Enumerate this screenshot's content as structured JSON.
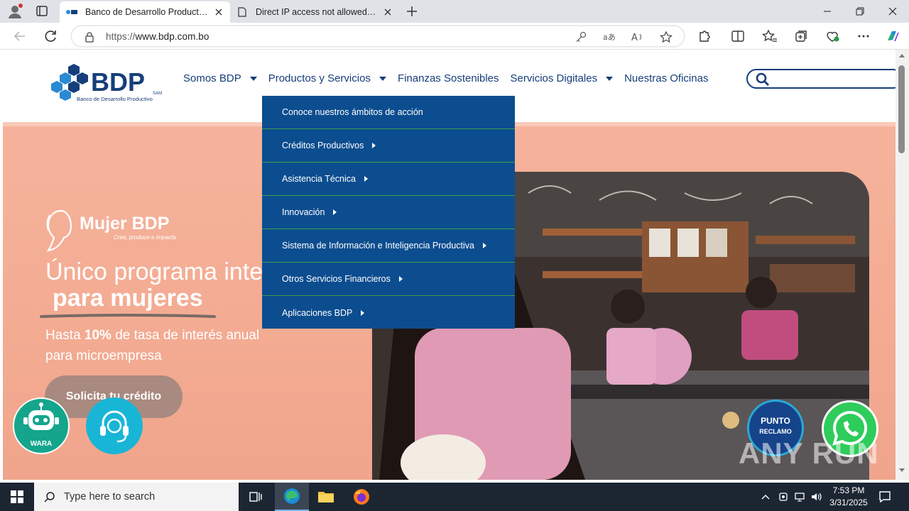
{
  "browser": {
    "tabs": [
      {
        "title": "Banco de Desarrollo Productivo -",
        "active": true
      },
      {
        "title": "Direct IP access not allowed | Clo",
        "active": false
      }
    ],
    "url_host": "https://www.bdp.com.bo",
    "url_scheme": "https://",
    "url_domain": "www.bdp.com.bo"
  },
  "site": {
    "logo_text": "BDP",
    "logo_sam": "SAM",
    "logo_subtitle": "Banco de Desarrollo Productivo",
    "menu": [
      {
        "label": "Somos BDP",
        "has_caret": true
      },
      {
        "label": "Productos y Servicios",
        "has_caret": true
      },
      {
        "label": "Finanzas Sostenibles",
        "has_caret": false
      },
      {
        "label": "Servicios Digitales",
        "has_caret": true
      },
      {
        "label": "Nuestras Oficinas",
        "has_caret": false
      }
    ],
    "dropdown": [
      {
        "label": "Conoce nuestros ámbitos de acción",
        "sub": false
      },
      {
        "label": "Créditos Productivos",
        "sub": true
      },
      {
        "label": "Asistencia Técnica",
        "sub": true
      },
      {
        "label": "Innovación",
        "sub": true
      },
      {
        "label": "Sistema de Información e Inteligencia Productiva",
        "sub": true
      },
      {
        "label": "Otros Servicios Financieros",
        "sub": true
      },
      {
        "label": "Aplicaciones BDP",
        "sub": true
      }
    ],
    "hero": {
      "brand_name": "Mujer BDP",
      "brand_tagline": "Crea, produce e impacta",
      "headline_1": "Único programa inte",
      "headline_2": "para mujeres",
      "sub_prefix": "Hasta ",
      "sub_highlight": "10%",
      "sub_suffix": " de tasa de interés anual",
      "sub_line2": "para microempresa",
      "cta": "Solicita tu crédito"
    },
    "floating": {
      "wara_label": "WARA",
      "reclamo_line1": "PUNTO",
      "reclamo_line2": "RECLAMO"
    },
    "watermark": "ANY RUN"
  },
  "taskbar": {
    "search_placeholder": "Type here to search",
    "time": "7:53 PM",
    "date": "3/31/2025"
  },
  "colors": {
    "brand_blue": "#163e7a",
    "dropdown_bg": "#0c4d8f",
    "dropdown_divider": "#3b9f4c",
    "hero_bg": "#f6b39c"
  }
}
